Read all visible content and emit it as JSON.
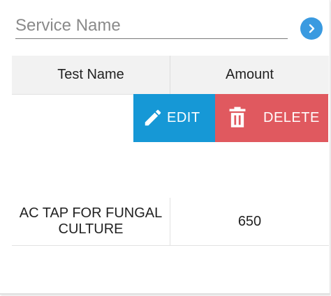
{
  "search": {
    "placeholder": "Service Name",
    "value": ""
  },
  "table": {
    "headers": [
      "Test Name",
      "Amount"
    ],
    "rows": [
      {
        "test_name": "AC TAP FOR FUNGAL CULTURE",
        "amount": "650"
      }
    ]
  },
  "actions": {
    "edit_label": "EDIT",
    "delete_label": "DELETE"
  },
  "icons": {
    "go": "chevron-right-icon",
    "edit": "pencil-icon",
    "delete": "trash-icon"
  },
  "colors": {
    "accent": "#3a9ae0",
    "edit": "#1698d6",
    "delete": "#e0595f",
    "header_bg": "#f2f2f2"
  }
}
